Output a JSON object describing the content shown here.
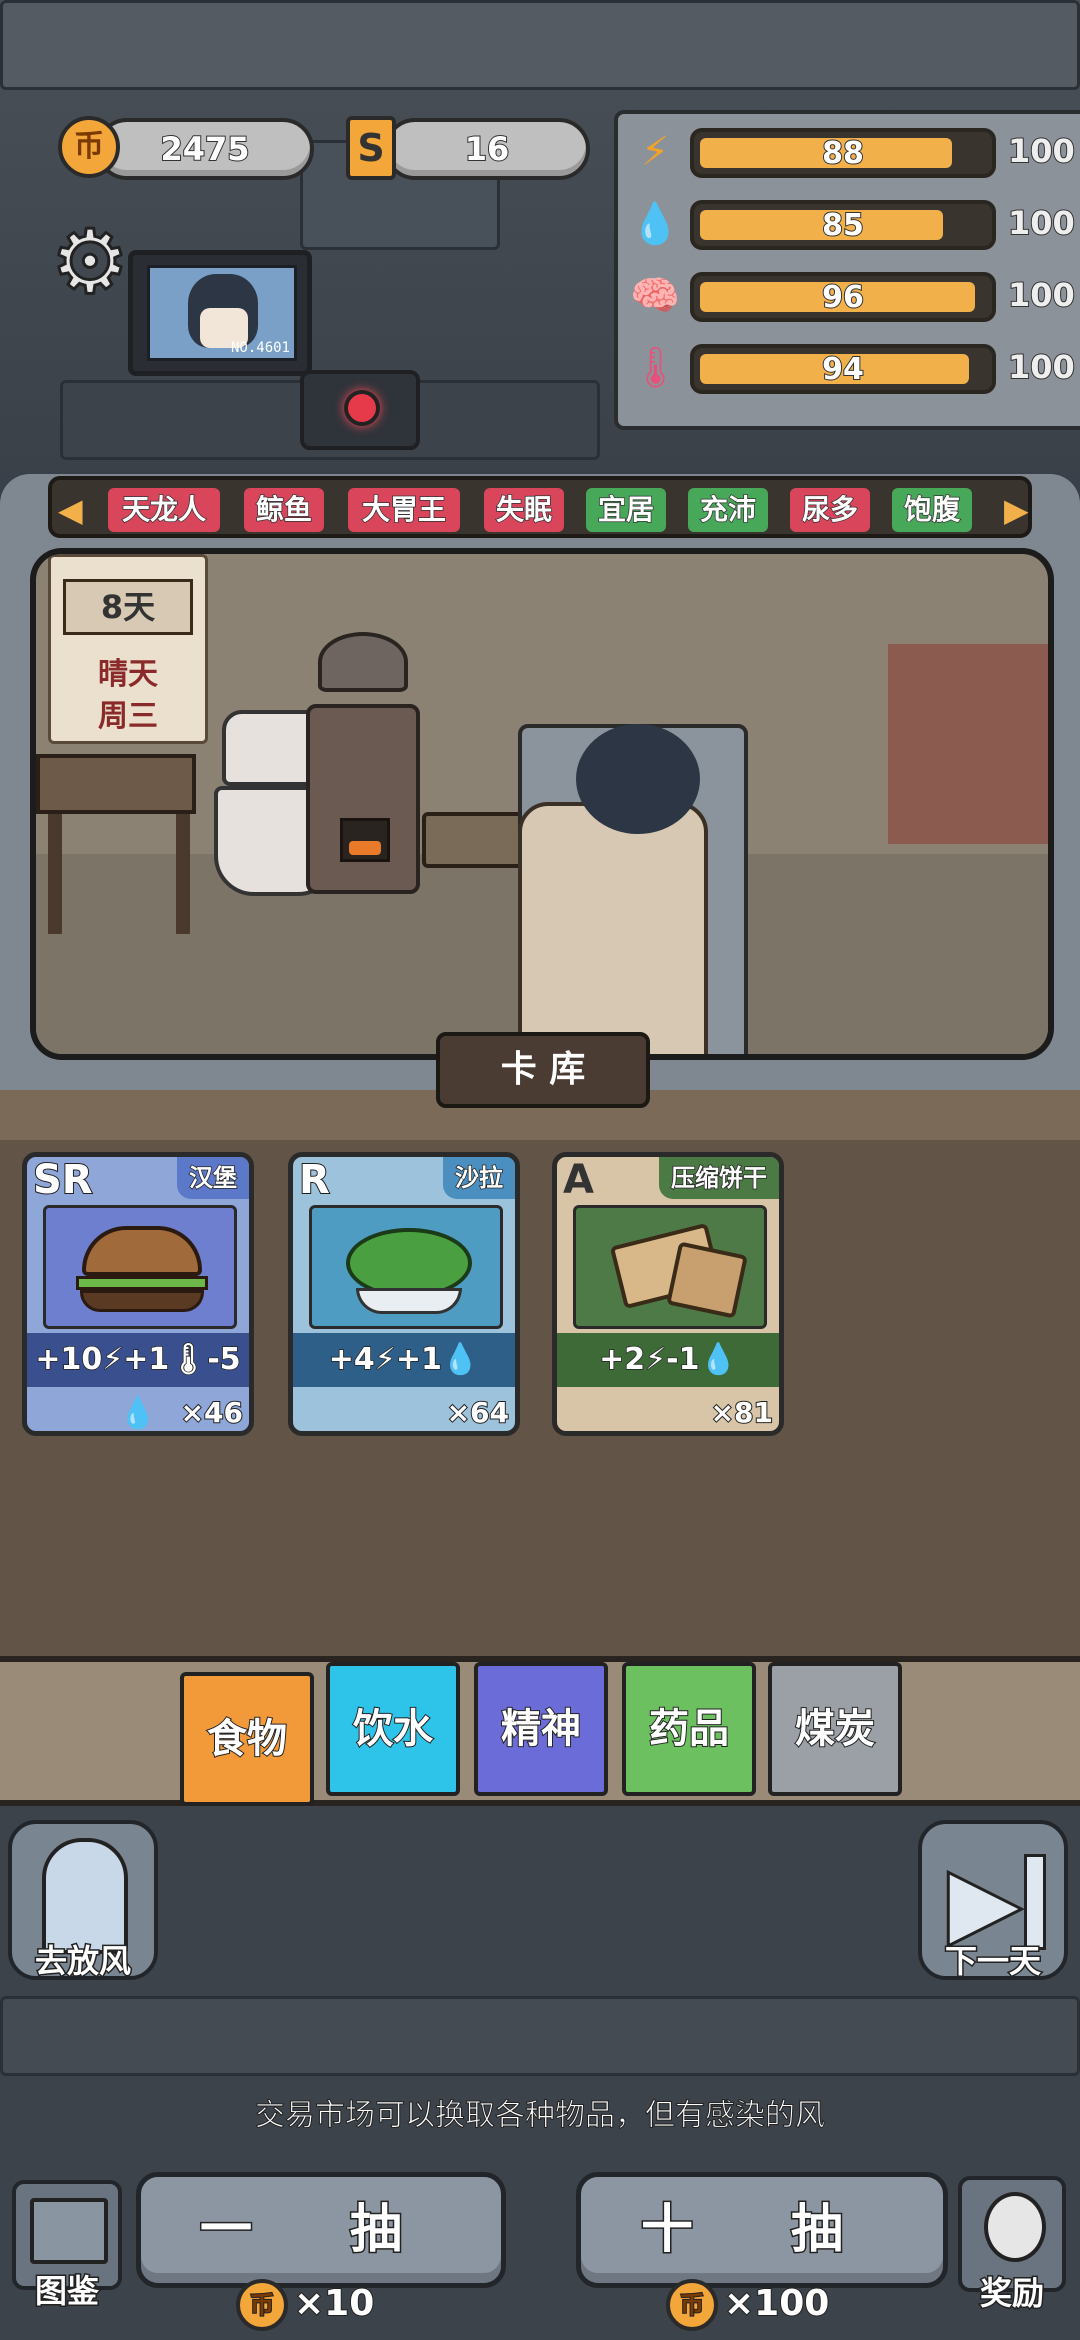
{
  "currency": {
    "coins": "2475",
    "coin_icon": "币",
    "tickets": "16",
    "ticket_icon": "S"
  },
  "stats": [
    {
      "icon": "energy-icon",
      "glyph": "⚡",
      "value": "88",
      "max": "100",
      "level": 0.88
    },
    {
      "icon": "water-icon",
      "glyph": "💧",
      "value": "85",
      "max": "100",
      "level": 0.85
    },
    {
      "icon": "brain-icon",
      "glyph": "🧠",
      "value": "96",
      "max": "100",
      "level": 0.96
    },
    {
      "icon": "thermometer-icon",
      "glyph": "🌡",
      "value": "94",
      "max": "100",
      "level": 0.94
    }
  ],
  "monitor": {
    "label": "NO.4601"
  },
  "tags": [
    {
      "label": "天龙人",
      "color": "#d9455a"
    },
    {
      "label": "鲸鱼",
      "color": "#d9455a"
    },
    {
      "label": "大胃王",
      "color": "#d9455a"
    },
    {
      "label": "失眠",
      "color": "#d9455a"
    },
    {
      "label": "宜居",
      "color": "#47a85a"
    },
    {
      "label": "充沛",
      "color": "#47a85a"
    },
    {
      "label": "尿多",
      "color": "#d9455a"
    },
    {
      "label": "饱腹",
      "color": "#47a85a"
    }
  ],
  "calendar": {
    "days": "8天",
    "weather": "晴天",
    "weekday": "周三"
  },
  "library_title": "卡 库",
  "cards": [
    {
      "rarity": "SR",
      "name": "汉堡",
      "effect": "+10⚡+1🌡-5💧",
      "count": "×46",
      "bg": "#8ea6d8",
      "tag_bg": "#5b79c8",
      "eff_bg": "#3a4f8e",
      "pic_bg": "#6f7fd0"
    },
    {
      "rarity": "R",
      "name": "沙拉",
      "effect": "+4⚡+1💧",
      "count": "×64",
      "bg": "#9cc2dc",
      "tag_bg": "#4a8fbf",
      "eff_bg": "#2e5f88",
      "pic_bg": "#4f9cc2"
    },
    {
      "rarity": "A",
      "name": "压缩饼干",
      "effect": "+2⚡-1💧",
      "count": "×81",
      "bg": "#d8c4a6",
      "tag_bg": "#4b7a44",
      "eff_bg": "#3e6a38",
      "pic_bg": "#4e7a48"
    }
  ],
  "categories": [
    {
      "label": "食物",
      "color": "#f29a3a"
    },
    {
      "label": "饮水",
      "color": "#2ec4ea"
    },
    {
      "label": "精神",
      "color": "#6b6cd8"
    },
    {
      "label": "药品",
      "color": "#6cc060"
    },
    {
      "label": "煤炭",
      "color": "#9aa0a6"
    }
  ],
  "buttons": {
    "go_out": "去放风",
    "next_day": "下一天",
    "codex": "图鉴",
    "reward": "奖励",
    "draw_one": "一 抽",
    "draw_ten": "十 抽",
    "draw_one_cost": "×10",
    "draw_ten_cost": "×100"
  },
  "tip": "交易市场可以换取各种物品，但有感染的风"
}
